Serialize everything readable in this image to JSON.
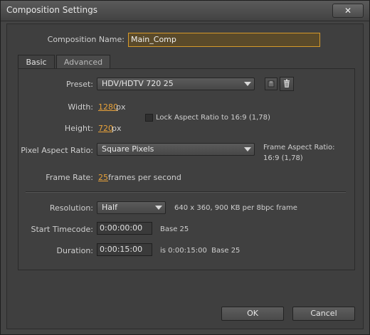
{
  "window": {
    "title": "Composition Settings",
    "close_label": "✕"
  },
  "composition_name": {
    "label": "Composition Name:",
    "value": "Main_Comp"
  },
  "tabs": [
    {
      "label": "Basic"
    },
    {
      "label": "Advanced"
    }
  ],
  "preset": {
    "label": "Preset:",
    "value": "HDV/HDTV 720 25"
  },
  "width": {
    "label": "Width:",
    "value": "1280",
    "unit": "px"
  },
  "lock_aspect": {
    "label": "Lock Aspect Ratio to 16:9 (1,78)",
    "checked": false
  },
  "height": {
    "label": "Height:",
    "value": "720",
    "unit": "px"
  },
  "pixel_aspect": {
    "label": "Pixel Aspect Ratio:",
    "value": "Square Pixels",
    "frame_aspect_label": "Frame Aspect Ratio:",
    "frame_aspect_value": "16:9 (1,78)"
  },
  "frame_rate": {
    "label": "Frame Rate:",
    "value": "25",
    "unit": "frames per second"
  },
  "resolution": {
    "label": "Resolution:",
    "value": "Half",
    "info": "640 x 360, 900 KB per 8bpc frame"
  },
  "start_timecode": {
    "label": "Start Timecode:",
    "value": "0:00:00:00",
    "info": "Base 25"
  },
  "duration": {
    "label": "Duration:",
    "value": "0:00:15:00",
    "info": "is 0:00:15:00  Base 25"
  },
  "buttons": {
    "ok": "OK",
    "cancel": "Cancel"
  },
  "icons": {
    "save_preset": "save-preset-icon",
    "delete_preset": "trash-icon"
  }
}
